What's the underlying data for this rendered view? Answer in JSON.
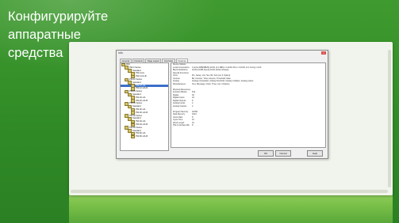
{
  "slide": {
    "title_lines": [
      "Конфигурируйте",
      "аппаратные",
      "средства"
    ],
    "colors": {
      "background": "#2f8a26",
      "ground": "#7cc24a"
    }
  },
  "dialog": {
    "title": "Info",
    "close": "x",
    "tabs": [
      {
        "label": "General",
        "active": false
      },
      {
        "label": "Contents",
        "active": false
      },
      {
        "label": "Page Layout",
        "active": false
      },
      {
        "label": "Overview",
        "active": false
      },
      {
        "label": "Features",
        "active": true
      }
    ],
    "tree": [
      {
        "label": "PAC",
        "level": 0,
        "selected": false
      },
      {
        "label": "PW-4 Series",
        "level": 1,
        "selected": false
      },
      {
        "label": "Standard",
        "level": 2,
        "selected": false
      },
      {
        "label": "PW-4-UA",
        "level": 3,
        "selected": false
      },
      {
        "label": "PW-4-UA-B",
        "level": 3,
        "selected": false
      },
      {
        "label": "PW-12 Series",
        "level": 1,
        "selected": false
      },
      {
        "label": "Standard",
        "level": 2,
        "selected": false
      },
      {
        "label": "PW-12-UA",
        "level": 3,
        "selected": true
      },
      {
        "label": "PW-12-UA-B",
        "level": 3,
        "selected": false
      },
      {
        "label": "PW-20 Series",
        "level": 1,
        "selected": false
      },
      {
        "label": "Standard",
        "level": 2,
        "selected": false
      },
      {
        "label": "PW-20-UA",
        "level": 3,
        "selected": false
      },
      {
        "label": "PW-20-UA-B",
        "level": 3,
        "selected": false
      },
      {
        "label": "PW-30 Series",
        "level": 1,
        "selected": false
      },
      {
        "label": "Standard",
        "level": 2,
        "selected": false
      },
      {
        "label": "PW-30-UA",
        "level": 3,
        "selected": false
      },
      {
        "label": "PW-30-UA-B",
        "level": 3,
        "selected": false
      },
      {
        "label": "PW-40 Series",
        "level": 1,
        "selected": false
      },
      {
        "label": "Standard",
        "level": 2,
        "selected": false
      },
      {
        "label": "PW-40-UA",
        "level": 3,
        "selected": false
      },
      {
        "label": "PW-40-UA-B",
        "level": 3,
        "selected": false
      },
      {
        "label": "PW-60 Series",
        "level": 1,
        "selected": false
      },
      {
        "label": "Standard",
        "level": 2,
        "selected": false
      },
      {
        "label": "PW-60-UA",
        "level": 3,
        "selected": false
      },
      {
        "label": "PW-60-UA-B",
        "level": 3,
        "selected": false
      }
    ],
    "properties": [
      {
        "key": "Device Models",
        "value": ""
      },
      {
        "key": "Local Connections",
        "value": "4 ports (DB9/DB25) ACD1 (4:1 DB9) / 2 ACD1 PLA / 3 ACD1 (4:1 Comp) / AUX"
      },
      {
        "key": "Block Definitions",
        "value": "AUXA AUXB (Input) ACD1 ACD2 (Output)"
      },
      {
        "key": "Special Functions",
        "value": ""
      },
      {
        "key": "Units",
        "value": "Pin, Setup, Lib, Hex, Bit, Sub (rev 4 Option)"
      },
      {
        "key": "Counter",
        "value": "Bit, Counter, Timer, Events, Threshold, Rate"
      },
      {
        "key": "Analog",
        "value": "Analog comparator, Analog threshold, Analog multiplex, Analog output"
      },
      {
        "key": "Miscellaneous",
        "value": "Text, Message, Clock, Timer (rev 4 Option)"
      },
      {
        "key": "",
        "value": ""
      },
      {
        "key": "Physical Resources",
        "value": ""
      },
      {
        "key": "Function Blocks",
        "value": "512"
      },
      {
        "key": "Digital",
        "value": "32"
      },
      {
        "key": "Digital Inputs",
        "value": "24"
      },
      {
        "key": "Digital Outputs",
        "value": "8"
      },
      {
        "key": "Analog Inputs",
        "value": "4"
      },
      {
        "key": "Analog Outputs",
        "value": "2"
      },
      {
        "key": "",
        "value": ""
      },
      {
        "key": "Program Memory",
        "value": "32768"
      },
      {
        "key": "Data Memory",
        "value": "1024"
      },
      {
        "key": "Clock Rate",
        "value": "8"
      },
      {
        "key": "Cycle Time",
        "value": "10"
      },
      {
        "key": "Word Length",
        "value": "16"
      },
      {
        "key": "PW-4 Interface Bin",
        "value": "8"
      }
    ],
    "buttons": {
      "ok": "OK",
      "cancel": "Cancel",
      "help": "Help"
    }
  }
}
